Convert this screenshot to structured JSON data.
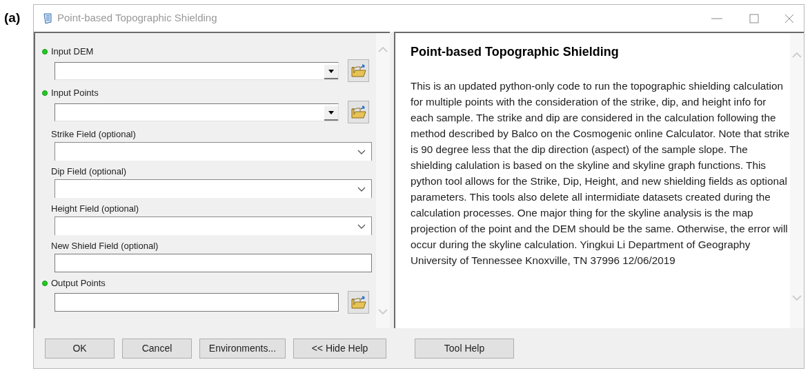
{
  "figure_label": "(a)",
  "window": {
    "title": "Point-based Topographic Shielding"
  },
  "parameters": [
    {
      "label": "Input DEM",
      "kind": "combo",
      "required": true
    },
    {
      "label": "Input Points",
      "kind": "combo",
      "required": true
    },
    {
      "label": "Strike Field (optional)",
      "kind": "select",
      "required": false
    },
    {
      "label": "Dip Field (optional)",
      "kind": "select",
      "required": false
    },
    {
      "label": "Height Field (optional)",
      "kind": "select",
      "required": false
    },
    {
      "label": "New Shield Field (optional)",
      "kind": "text",
      "required": false
    },
    {
      "label": "Output Points",
      "kind": "output",
      "required": true
    }
  ],
  "help": {
    "title": "Point-based Topographic Shielding",
    "body": "This is an updated python-only code to run the topographic shielding calculation for multiple points with the consideration of the strike, dip, and height info for each sample. The strike and dip are considered in the calculation following the method described by Balco on the Cosmogenic online Calculator. Note that strike is 90 degree less that the dip direction (aspect) of the sample slope. The shielding calulation is based on the skyline and skyline graph functions. This python tool allows for the Strike, Dip, Height, and new shielding fields as optional parameters. This tools also delete all intermidiate datasets created during the calculation processes. One major thing for the skyline analysis is the map projection of the point and the DEM should be the same. Otherwise, the error will occur during the skyline calculation. Yingkui Li Department of Geography University of Tennessee Knoxville, TN 37996 12/06/2019"
  },
  "buttons": [
    "OK",
    "Cancel",
    "Environments...",
    "<< Hide Help"
  ],
  "help_button": "Tool Help"
}
